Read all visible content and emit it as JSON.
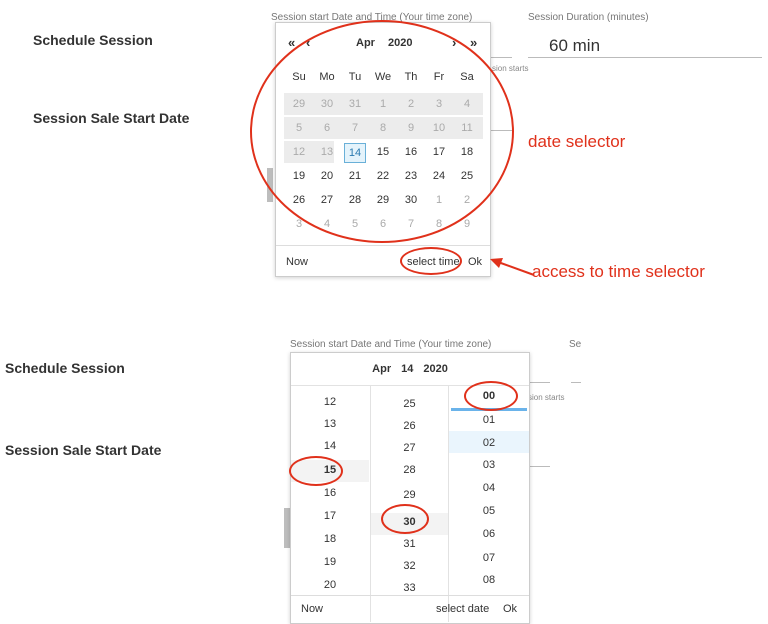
{
  "top": {
    "labels": {
      "schedule": "Schedule Session",
      "sale_start": "Session Sale Start Date"
    },
    "start_caption": "Session start Date and Time (Your time zone)",
    "duration_caption": "Session Duration (minutes)",
    "duration_value": "60 min",
    "hint_partial": "sion starts",
    "calendar": {
      "prev_year": "«",
      "prev_month": "‹",
      "next_month": "›",
      "next_year": "»",
      "month": "Apr",
      "year": "2020",
      "weekdays": [
        "Su",
        "Mo",
        "Tu",
        "We",
        "Th",
        "Fr",
        "Sa"
      ],
      "weeks": [
        [
          "29",
          "30",
          "31",
          "1",
          "2",
          "3",
          "4"
        ],
        [
          "5",
          "6",
          "7",
          "8",
          "9",
          "10",
          "11"
        ],
        [
          "12",
          "13",
          "14",
          "15",
          "16",
          "17",
          "18"
        ],
        [
          "19",
          "20",
          "21",
          "22",
          "23",
          "24",
          "25"
        ],
        [
          "26",
          "27",
          "28",
          "29",
          "30",
          "1",
          "2"
        ],
        [
          "3",
          "4",
          "5",
          "6",
          "7",
          "8",
          "9"
        ]
      ],
      "footer": {
        "now": "Now",
        "select_time": "select time",
        "ok": "Ok"
      }
    },
    "annotations": {
      "date_selector": "date selector",
      "time_access": "access to time selector"
    }
  },
  "bottom": {
    "labels": {
      "schedule": "Schedule Session",
      "sale_start": "Session Sale Start Date"
    },
    "start_caption": "Session start Date and Time (Your time zone)",
    "duration_caption_partial": "Se",
    "hint_partial": "sion starts",
    "header": {
      "month": "Apr",
      "day": "14",
      "year": "2020"
    },
    "hours": [
      "12",
      "13",
      "14",
      "15",
      "16",
      "17",
      "18",
      "19",
      "20"
    ],
    "minutes": [
      "25",
      "26",
      "27",
      "28",
      "29",
      "30",
      "31",
      "32",
      "33"
    ],
    "seconds": [
      "00",
      "01",
      "02",
      "03",
      "04",
      "05",
      "06",
      "07",
      "08"
    ],
    "footer": {
      "now": "Now",
      "select_date": "select date",
      "ok": "Ok"
    }
  },
  "colors": {
    "annotation": "#e0311b",
    "selected_day_border": "#69b0d8",
    "selected_day_bg": "#e4f3fb",
    "muted_row_bg": "#ececec"
  }
}
